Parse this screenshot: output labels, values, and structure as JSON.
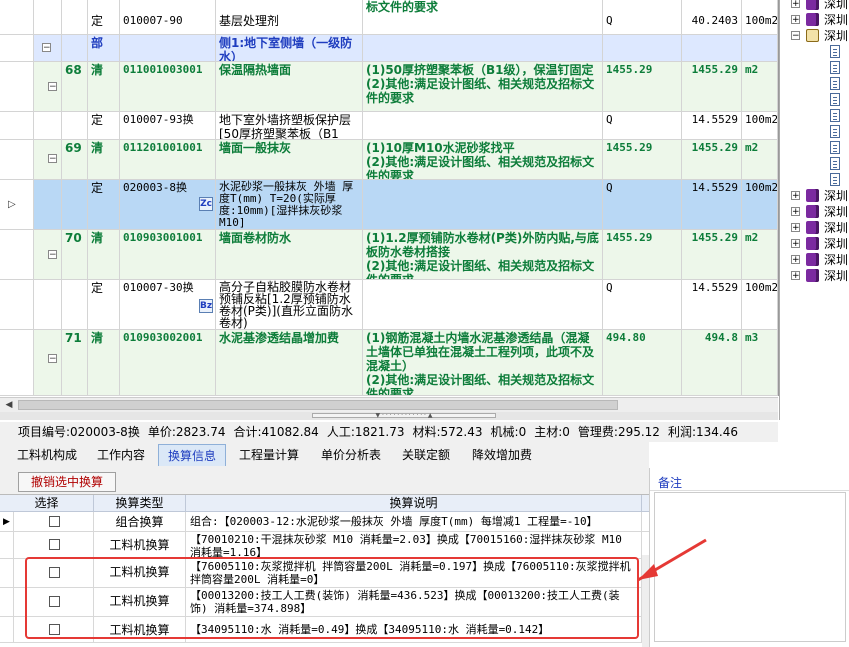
{
  "grid": {
    "rows": [
      {
        "kind": "sub",
        "type": "定",
        "code": "010007-90",
        "name": "基层处理剂",
        "feature": "",
        "unit": "Q",
        "qty": "40.2403",
        "unit2": "100m2",
        "feature_top": "标文件的要求"
      },
      {
        "kind": "bu",
        "type": "部",
        "code": "",
        "name": "侧1:地下室侧墙（一级防水）",
        "feature": "",
        "unit": "",
        "qty": "",
        "unit2": ""
      },
      {
        "kind": "qd",
        "seq": "68",
        "type": "清",
        "code": "011001003001",
        "name": "保温隔热墙面",
        "feature": "(1)50厚挤塑聚苯板（B1级），保温钉固定\n(2)其他:满足设计图纸、相关规范及招标文件的要求",
        "unit": "1455.29",
        "qty": "1455.29",
        "unit2": "m2"
      },
      {
        "kind": "sub",
        "type": "定",
        "code": "010007-93换",
        "name": "地下室外墙挤塑板保护层[50厚挤塑聚苯板（B1级）]",
        "feature": "",
        "unit": "Q",
        "qty": "14.5529",
        "unit2": "100m2"
      },
      {
        "kind": "qd",
        "seq": "69",
        "type": "清",
        "code": "011201001001",
        "name": "墙面一般抹灰",
        "feature": "(1)10厚M10水泥砂浆找平\n(2)其他:满足设计图纸、相关规范及招标文件的要求",
        "unit": "1455.29",
        "qty": "1455.29",
        "unit2": "m2"
      },
      {
        "kind": "sel",
        "type": "定",
        "code": "020003-8换",
        "name": "水泥砂浆一般抹灰 外墙 厚度T(mm) T=20(实际厚度:10mm)[湿拌抹灰砂浆 M10]",
        "badge": "Zc",
        "feature": "",
        "unit": "Q",
        "qty": "14.5529",
        "unit2": "100m2"
      },
      {
        "kind": "qd",
        "seq": "70",
        "type": "清",
        "code": "010903001001",
        "name": "墙面卷材防水",
        "feature": "(1)1.2厚预铺防水卷材(P类)外防内贴,与底板防水卷材搭接\n(2)其他:满足设计图纸、相关规范及招标文件的要求",
        "unit": "1455.29",
        "qty": "1455.29",
        "unit2": "m2"
      },
      {
        "kind": "sub",
        "type": "定",
        "code": "010007-30换",
        "name": "高分子自粘胶膜防水卷材预铺反粘[1.2厚预铺防水卷材(P类)](直形立面防水卷材)",
        "badge": "Bz",
        "feature": "",
        "unit": "Q",
        "qty": "14.5529",
        "unit2": "100m2"
      },
      {
        "kind": "qd",
        "seq": "71",
        "type": "清",
        "code": "010903002001",
        "name": "水泥基渗透结晶增加费",
        "feature": "(1)钢筋混凝土内墙水泥基渗透结晶（混凝土墙体已单独在混凝土工程列项，此项不及混凝土）\n(2)其他:满足设计图纸、相关规范及招标文件的要求",
        "unit": "494.80",
        "qty": "494.8",
        "unit2": "m3"
      }
    ]
  },
  "tree": {
    "label": "深圳",
    "items_count": 19
  },
  "info": {
    "item_code": "项目编号:020003-8换",
    "unit_price": "单价:2823.74",
    "total": "合计:41082.84",
    "labor": "人工:1821.73",
    "material": "材料:572.43",
    "machine": "机械:0",
    "main_material": "主材:0",
    "mgmt_fee": "管理费:295.12",
    "profit": "利润:134.46"
  },
  "tabs": [
    {
      "label": "工料机构成",
      "active": false
    },
    {
      "label": "工作内容",
      "active": false
    },
    {
      "label": "换算信息",
      "active": true
    },
    {
      "label": "工程量计算",
      "active": false
    },
    {
      "label": "单价分析表",
      "active": false
    },
    {
      "label": "关联定额",
      "active": false
    },
    {
      "label": "降效增加费",
      "active": false
    }
  ],
  "lower": {
    "undo_label": "撤销选中换算",
    "headers": {
      "select": "选择",
      "type": "换算类型",
      "desc": "换算说明"
    },
    "rows": [
      {
        "type": "组合换算",
        "desc": "组合:【020003-12:水泥砂浆一般抹灰 外墙 厚度T(mm) 每增减1 工程量=-10】"
      },
      {
        "type": "工料机换算",
        "desc": "【70010210:干混抹灰砂浆 M10 消耗量=2.03】换成【70015160:湿拌抹灰砂浆 M10 消耗量=1.16】"
      },
      {
        "type": "工料机换算",
        "desc": "【76005110:灰浆搅拌机 拌筒容量200L 消耗量=0.197】换成【76005110:灰浆搅拌机 拌筒容量200L 消耗量=0】"
      },
      {
        "type": "工料机换算",
        "desc": "【00013200:技工人工费(装饰) 消耗量=436.523】换成【00013200:技工人工费(装饰) 消耗量=374.898】"
      },
      {
        "type": "工料机换算",
        "desc": "【34095110:水 消耗量=0.49】换成【34095110:水 消耗量=0.142】"
      }
    ]
  },
  "remarks": {
    "title": "备注"
  },
  "colors": {
    "highlight": "#e53935",
    "green_text": "#0d7d3a",
    "blue_text": "#1f3dbf",
    "selected_row": "#b9d8f5"
  }
}
